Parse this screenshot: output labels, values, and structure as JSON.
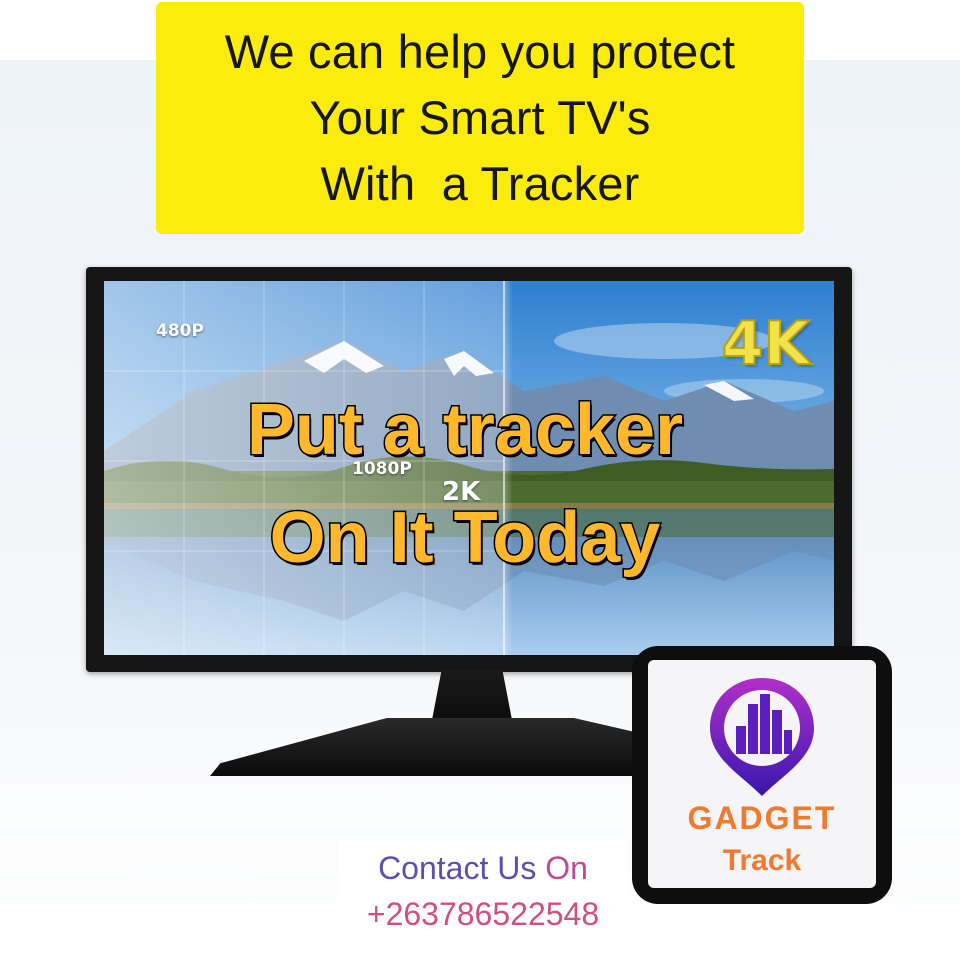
{
  "headline": {
    "lines": [
      "We can help you protect",
      "Your Smart TV's",
      "With  a Tracker"
    ]
  },
  "tv_screen": {
    "labels": {
      "low": "480P",
      "mid": "1080P",
      "high_mid": "2K",
      "top": "4K"
    }
  },
  "promo": {
    "line1": "Put a tracker",
    "line2": "On It Today"
  },
  "logo": {
    "brand_line1": "GADGET",
    "brand_line2": "Track",
    "icon": "map-pin-icon"
  },
  "contact": {
    "label_part1": "Contact Us",
    "label_part2": " On",
    "phone": "+263786522548"
  },
  "colors": {
    "headline_bg": "#fbec0b",
    "promo_text": "#ffb82b",
    "brand_orange": "#f07a2e",
    "pin_gradient_top": "#9b2bc9",
    "pin_gradient_bottom": "#3b1bb0"
  }
}
